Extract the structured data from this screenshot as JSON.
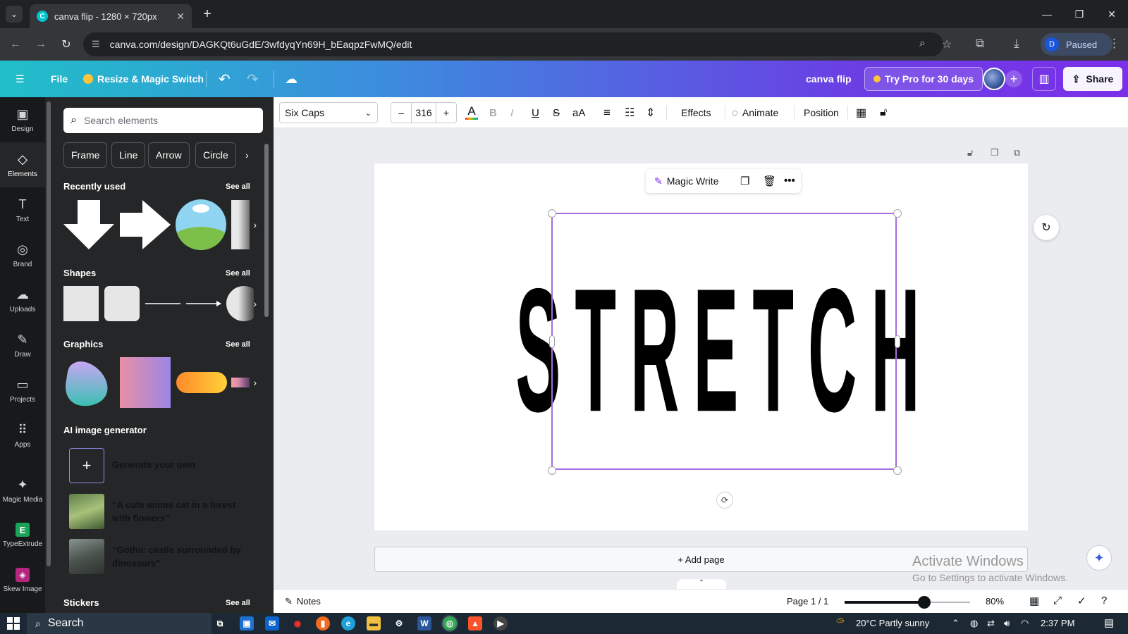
{
  "browser": {
    "tab_title": "canva flip - 1280 × 720px",
    "url": "canva.com/design/DAGKQt6uGdE/3wfdyqYn69H_bEaqpzFwMQ/edit",
    "profile_initial": "D",
    "profile_status": "Paused"
  },
  "header": {
    "file_label": "File",
    "resize_label": "Resize & Magic Switch",
    "doc_title": "canva flip",
    "try_pro_label": "Try Pro for 30 days",
    "share_label": "Share"
  },
  "rail": {
    "items": [
      {
        "label": "Design",
        "icon": "▣"
      },
      {
        "label": "Elements",
        "icon": "◇"
      },
      {
        "label": "Text",
        "icon": "T"
      },
      {
        "label": "Brand",
        "icon": "◎"
      },
      {
        "label": "Uploads",
        "icon": "☁"
      },
      {
        "label": "Draw",
        "icon": "✎"
      },
      {
        "label": "Projects",
        "icon": "▭"
      },
      {
        "label": "Apps",
        "icon": "⠿"
      },
      {
        "label": "Magic Media",
        "icon": "✦"
      },
      {
        "label": "TypeExtrude",
        "icon": "E"
      },
      {
        "label": "Skew Image",
        "icon": "◈"
      }
    ]
  },
  "panel": {
    "search_placeholder": "Search elements",
    "chips": [
      "Frame",
      "Line",
      "Arrow",
      "Circle"
    ],
    "sections": {
      "recent": "Recently used",
      "shapes": "Shapes",
      "graphics": "Graphics",
      "ai": "AI image generator",
      "stickers": "Stickers"
    },
    "see_all": "See all",
    "generate_label": "Generate your own",
    "ai_prompts": [
      "“A cute anime cat in a forest with flowers”",
      "“Gothic castle surrounded by dinosaurs”"
    ]
  },
  "toolbar": {
    "font_name": "Six Caps",
    "font_size": "316",
    "effects_label": "Effects",
    "animate_label": "Animate",
    "position_label": "Position"
  },
  "canvas": {
    "floating_label": "Magic Write",
    "text_content": "STRETCH",
    "add_page_label": "+ Add page"
  },
  "watermark": {
    "line1": "Activate Windows",
    "line2": "Go to Settings to activate Windows."
  },
  "bottombar": {
    "notes_label": "Notes",
    "page_indicator": "Page 1 / 1",
    "zoom_percent": 80,
    "zoom_label": "80%"
  },
  "taskbar": {
    "search_label": "Search",
    "weather": "20°C  Partly sunny",
    "time": "2:37 PM"
  },
  "colors": {
    "brand_gradient_start": "#20bfc9",
    "brand_gradient_end": "#7b2fe8",
    "selection": "#a56ce0"
  }
}
